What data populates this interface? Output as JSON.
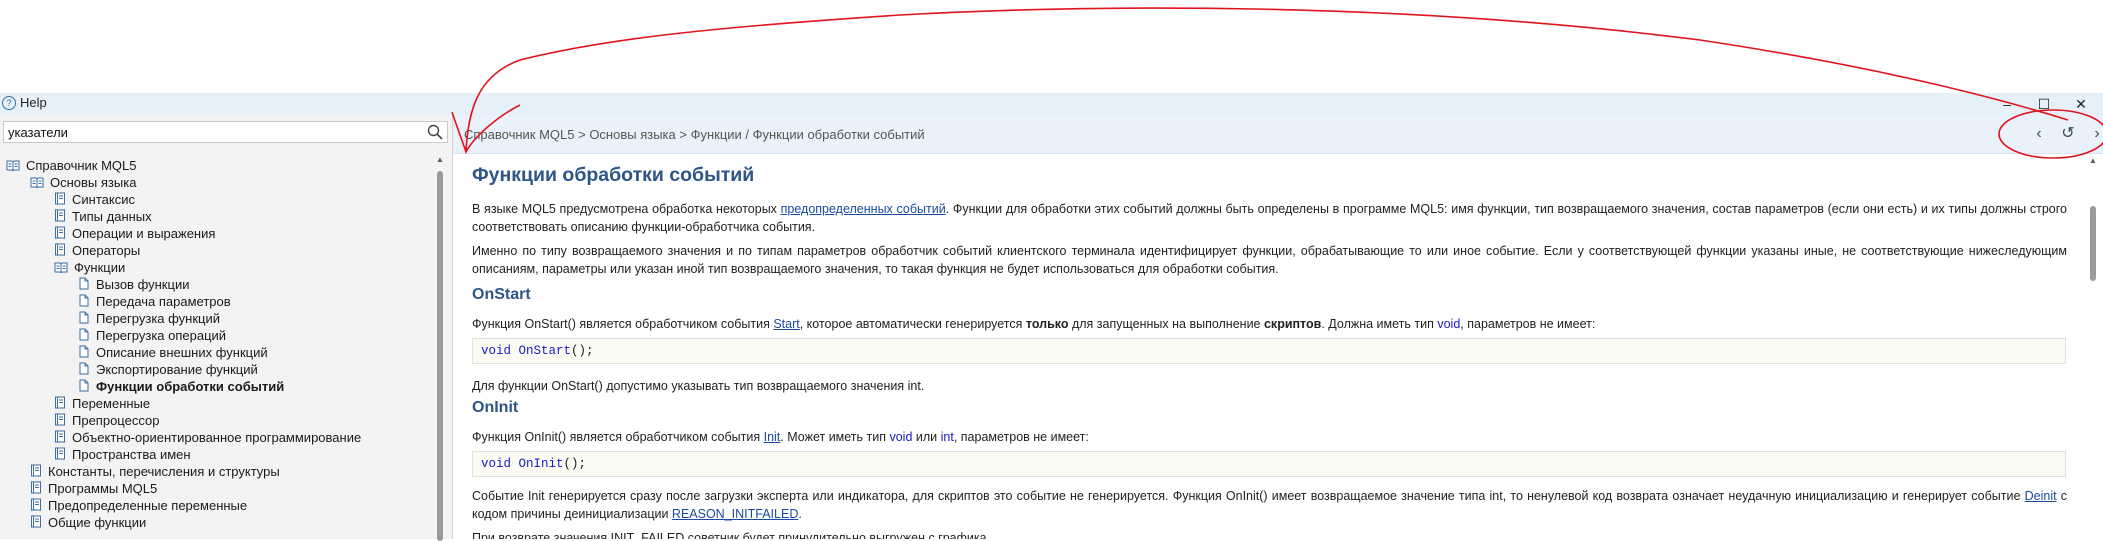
{
  "window": {
    "title": "Help",
    "minimize": "–",
    "maximize": "☐",
    "close": "✕"
  },
  "search": {
    "value": "указатели"
  },
  "tree": [
    {
      "label": "Справочник MQL5",
      "level": 0,
      "icon": "open-book-icon"
    },
    {
      "label": "Основы языка",
      "level": 1,
      "icon": "open-book-icon"
    },
    {
      "label": "Синтаксис",
      "level": 2,
      "icon": "book-icon"
    },
    {
      "label": "Типы данных",
      "level": 2,
      "icon": "book-icon"
    },
    {
      "label": "Операции и выражения",
      "level": 2,
      "icon": "book-icon"
    },
    {
      "label": "Операторы",
      "level": 2,
      "icon": "book-icon"
    },
    {
      "label": "Функции",
      "level": 2,
      "icon": "open-book-icon"
    },
    {
      "label": "Вызов функции",
      "level": 3,
      "icon": "page-icon"
    },
    {
      "label": "Передача параметров",
      "level": 3,
      "icon": "page-icon"
    },
    {
      "label": "Перегрузка функций",
      "level": 3,
      "icon": "page-icon"
    },
    {
      "label": "Перегрузка операций",
      "level": 3,
      "icon": "page-icon"
    },
    {
      "label": "Описание внешних функций",
      "level": 3,
      "icon": "page-icon"
    },
    {
      "label": "Экспортирование функций",
      "level": 3,
      "icon": "page-icon"
    },
    {
      "label": "Функции обработки событий",
      "level": 3,
      "icon": "page-icon",
      "active": true
    },
    {
      "label": "Переменные",
      "level": 2,
      "icon": "book-icon"
    },
    {
      "label": "Препроцессор",
      "level": 2,
      "icon": "book-icon"
    },
    {
      "label": "Объектно-ориентированное программирование",
      "level": 2,
      "icon": "book-icon"
    },
    {
      "label": "Пространства имен",
      "level": 2,
      "icon": "book-icon"
    },
    {
      "label": "Константы, перечисления и структуры",
      "level": 1,
      "icon": "book-icon"
    },
    {
      "label": "Программы MQL5",
      "level": 1,
      "icon": "book-icon"
    },
    {
      "label": "Предопределенные переменные",
      "level": 1,
      "icon": "book-icon"
    },
    {
      "label": "Общие функции",
      "level": 1,
      "icon": "book-icon"
    }
  ],
  "breadcrumb": "Справочник MQL5 > Основы языка > Функции  / Функции обработки событий",
  "nav": {
    "back": "‹",
    "refresh": "↺",
    "forward": "›"
  },
  "article": {
    "title": "Функции обработки событий",
    "p1_a": "В языке MQL5 предусмотрена обработка некоторых ",
    "p1_link": "предопределенных событий",
    "p1_b": ". Функции для обработки этих событий должны быть определены в программе MQL5: имя функции, тип возвращаемого значения, состав параметров (если они есть) и их типы должны строго соответствовать описанию функции-обработчика события.",
    "p2": "Именно по типу возвращаемого значения и по типам параметров обработчик событий клиентского терминала идентифицирует функции, обрабатывающие то или иное событие. Если у соответствующей функции указаны иные, не соответствующие нижеследующим описаниям, параметры или указан иной тип возвращаемого значения, то такая функция не будет использоваться для обработки события.",
    "h_onstart": "OnStart",
    "onstart_a": "Функция OnStart() является обработчиком события ",
    "onstart_link": "Start",
    "onstart_b": ", которое автоматически генерируется ",
    "onstart_bold1": "только",
    "onstart_c": " для запущенных на выполнение ",
    "onstart_bold2": "скриптов",
    "onstart_d": ". Должна иметь тип ",
    "onstart_kw": "void",
    "onstart_e": ", параметров не имеет:",
    "code1_kw": "void",
    "code1_fn": "OnStart",
    "code1_rest": "();",
    "onstart_note": "Для функции OnStart() допустимо указывать тип возвращаемого значения int.",
    "h_oninit": "OnInit",
    "oninit_a": "Функция OnInit() является обработчиком события ",
    "oninit_link": "Init",
    "oninit_b": ". Может иметь тип ",
    "oninit_kw1": "void",
    "oninit_c": " или ",
    "oninit_kw2": "int",
    "oninit_d": ", параметров не имеет:",
    "code2_kw": "void",
    "code2_fn": "OnInit",
    "code2_rest": "();",
    "oninit_p_a": "Событие Init генерируется сразу после загрузки эксперта или индикатора, для скриптов это событие не генерируется. Функция OnInit() имеет возвращаемое значение типа int, то ненулевой код возврата означает неудачную инициализацию и генерирует событие ",
    "oninit_p_link1": "Deinit",
    "oninit_p_b": " с кодом причины деинициализации ",
    "oninit_p_link2": "REASON_INITFAILED",
    "oninit_p_c": ".",
    "last_line": "При возврате значения INIT_FAILED советник будет принудительно выгружен с графика."
  },
  "colors": {
    "heading": "#2d5587",
    "link": "#1a4aa0",
    "keyword": "#1a1acc",
    "annotation": "#e0141e"
  }
}
